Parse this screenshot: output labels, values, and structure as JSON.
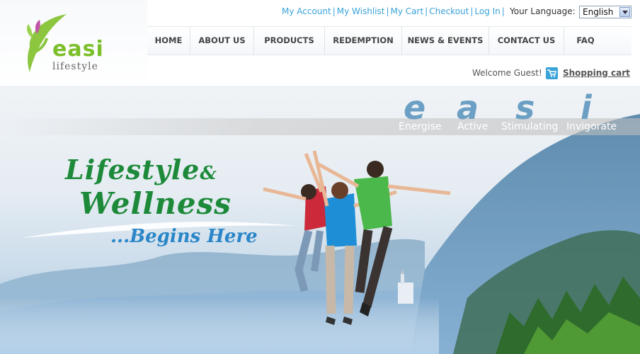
{
  "header": {
    "logo": {
      "word": "easi",
      "sub": "lifestyle"
    },
    "top_links": [
      "My Account",
      "My Wishlist",
      "My Cart",
      "Checkout",
      "Log In"
    ],
    "language_label": "Your Language:",
    "language_selected": "English",
    "nav": [
      "HOME",
      "ABOUT US",
      "PRODUCTS",
      "REDEMPTION",
      "NEWS & EVENTS",
      "CONTACT US",
      "FAQ"
    ],
    "welcome": "Welcome Guest!",
    "cart_label": "Shopping cart"
  },
  "hero": {
    "letters": [
      "e",
      "a",
      "s",
      "i"
    ],
    "words": [
      "Energise",
      "Active",
      "Stimulating",
      "Invigorate"
    ],
    "tagline_line1": "Lifestyle",
    "tagline_amp": "&",
    "tagline_line2": "Wellness",
    "tagline_line3": "...Begins Here"
  },
  "colors": {
    "link_blue": "#3aa3d8",
    "brand_green": "#1d8a3a",
    "tag_blue": "#2a86c8"
  }
}
